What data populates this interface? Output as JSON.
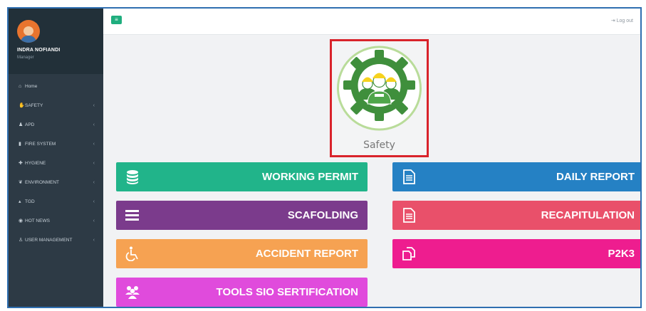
{
  "user": {
    "name": "INDRA NOFIANDI",
    "role": "Manager"
  },
  "header": {
    "logout_label": "Log out",
    "logout_icon": "logout-icon",
    "toggle_icon": "menu-toggle-icon"
  },
  "sidebar": {
    "items": [
      {
        "label": "Home",
        "icon": "home-icon",
        "has_chevron": false
      },
      {
        "label": "SAFETY",
        "icon": "thumbs-up-icon",
        "has_chevron": true
      },
      {
        "label": "APD",
        "icon": "person-icon",
        "has_chevron": true
      },
      {
        "label": "FIRE SYSTEM",
        "icon": "fire-extinguisher-icon",
        "has_chevron": true
      },
      {
        "label": "HYGIENE",
        "icon": "plus-icon",
        "has_chevron": true
      },
      {
        "label": "ENVIRONMENT",
        "icon": "leaf-icon",
        "has_chevron": true
      },
      {
        "label": "TGD",
        "icon": "signal-icon",
        "has_chevron": true
      },
      {
        "label": "HOT NEWS",
        "icon": "globe-icon",
        "has_chevron": true
      },
      {
        "label": "USER MANAGEMENT",
        "icon": "user-icon",
        "has_chevron": true
      }
    ]
  },
  "logo": {
    "caption": "Safety",
    "icon": "safety-workers-gear-logo"
  },
  "tiles": [
    {
      "label": "WORKING PERMIT",
      "icon": "database-icon",
      "color": "#21b48a"
    },
    {
      "label": "DAILY REPORT",
      "icon": "document-icon",
      "color": "#2581c4"
    },
    {
      "label": "SCAFOLDING",
      "icon": "bars-icon",
      "color": "#7b3b8c"
    },
    {
      "label": "RECAPITULATION",
      "icon": "document-icon",
      "color": "#e9506a"
    },
    {
      "label": "ACCIDENT REPORT",
      "icon": "wheelchair-icon",
      "color": "#f6a252"
    },
    {
      "label": "P2K3",
      "icon": "copy-icon",
      "color": "#ee1d8f"
    },
    {
      "label": "TOOLS SIO SERTIFICATION",
      "icon": "users-icon",
      "color": "#e04bdc"
    }
  ]
}
